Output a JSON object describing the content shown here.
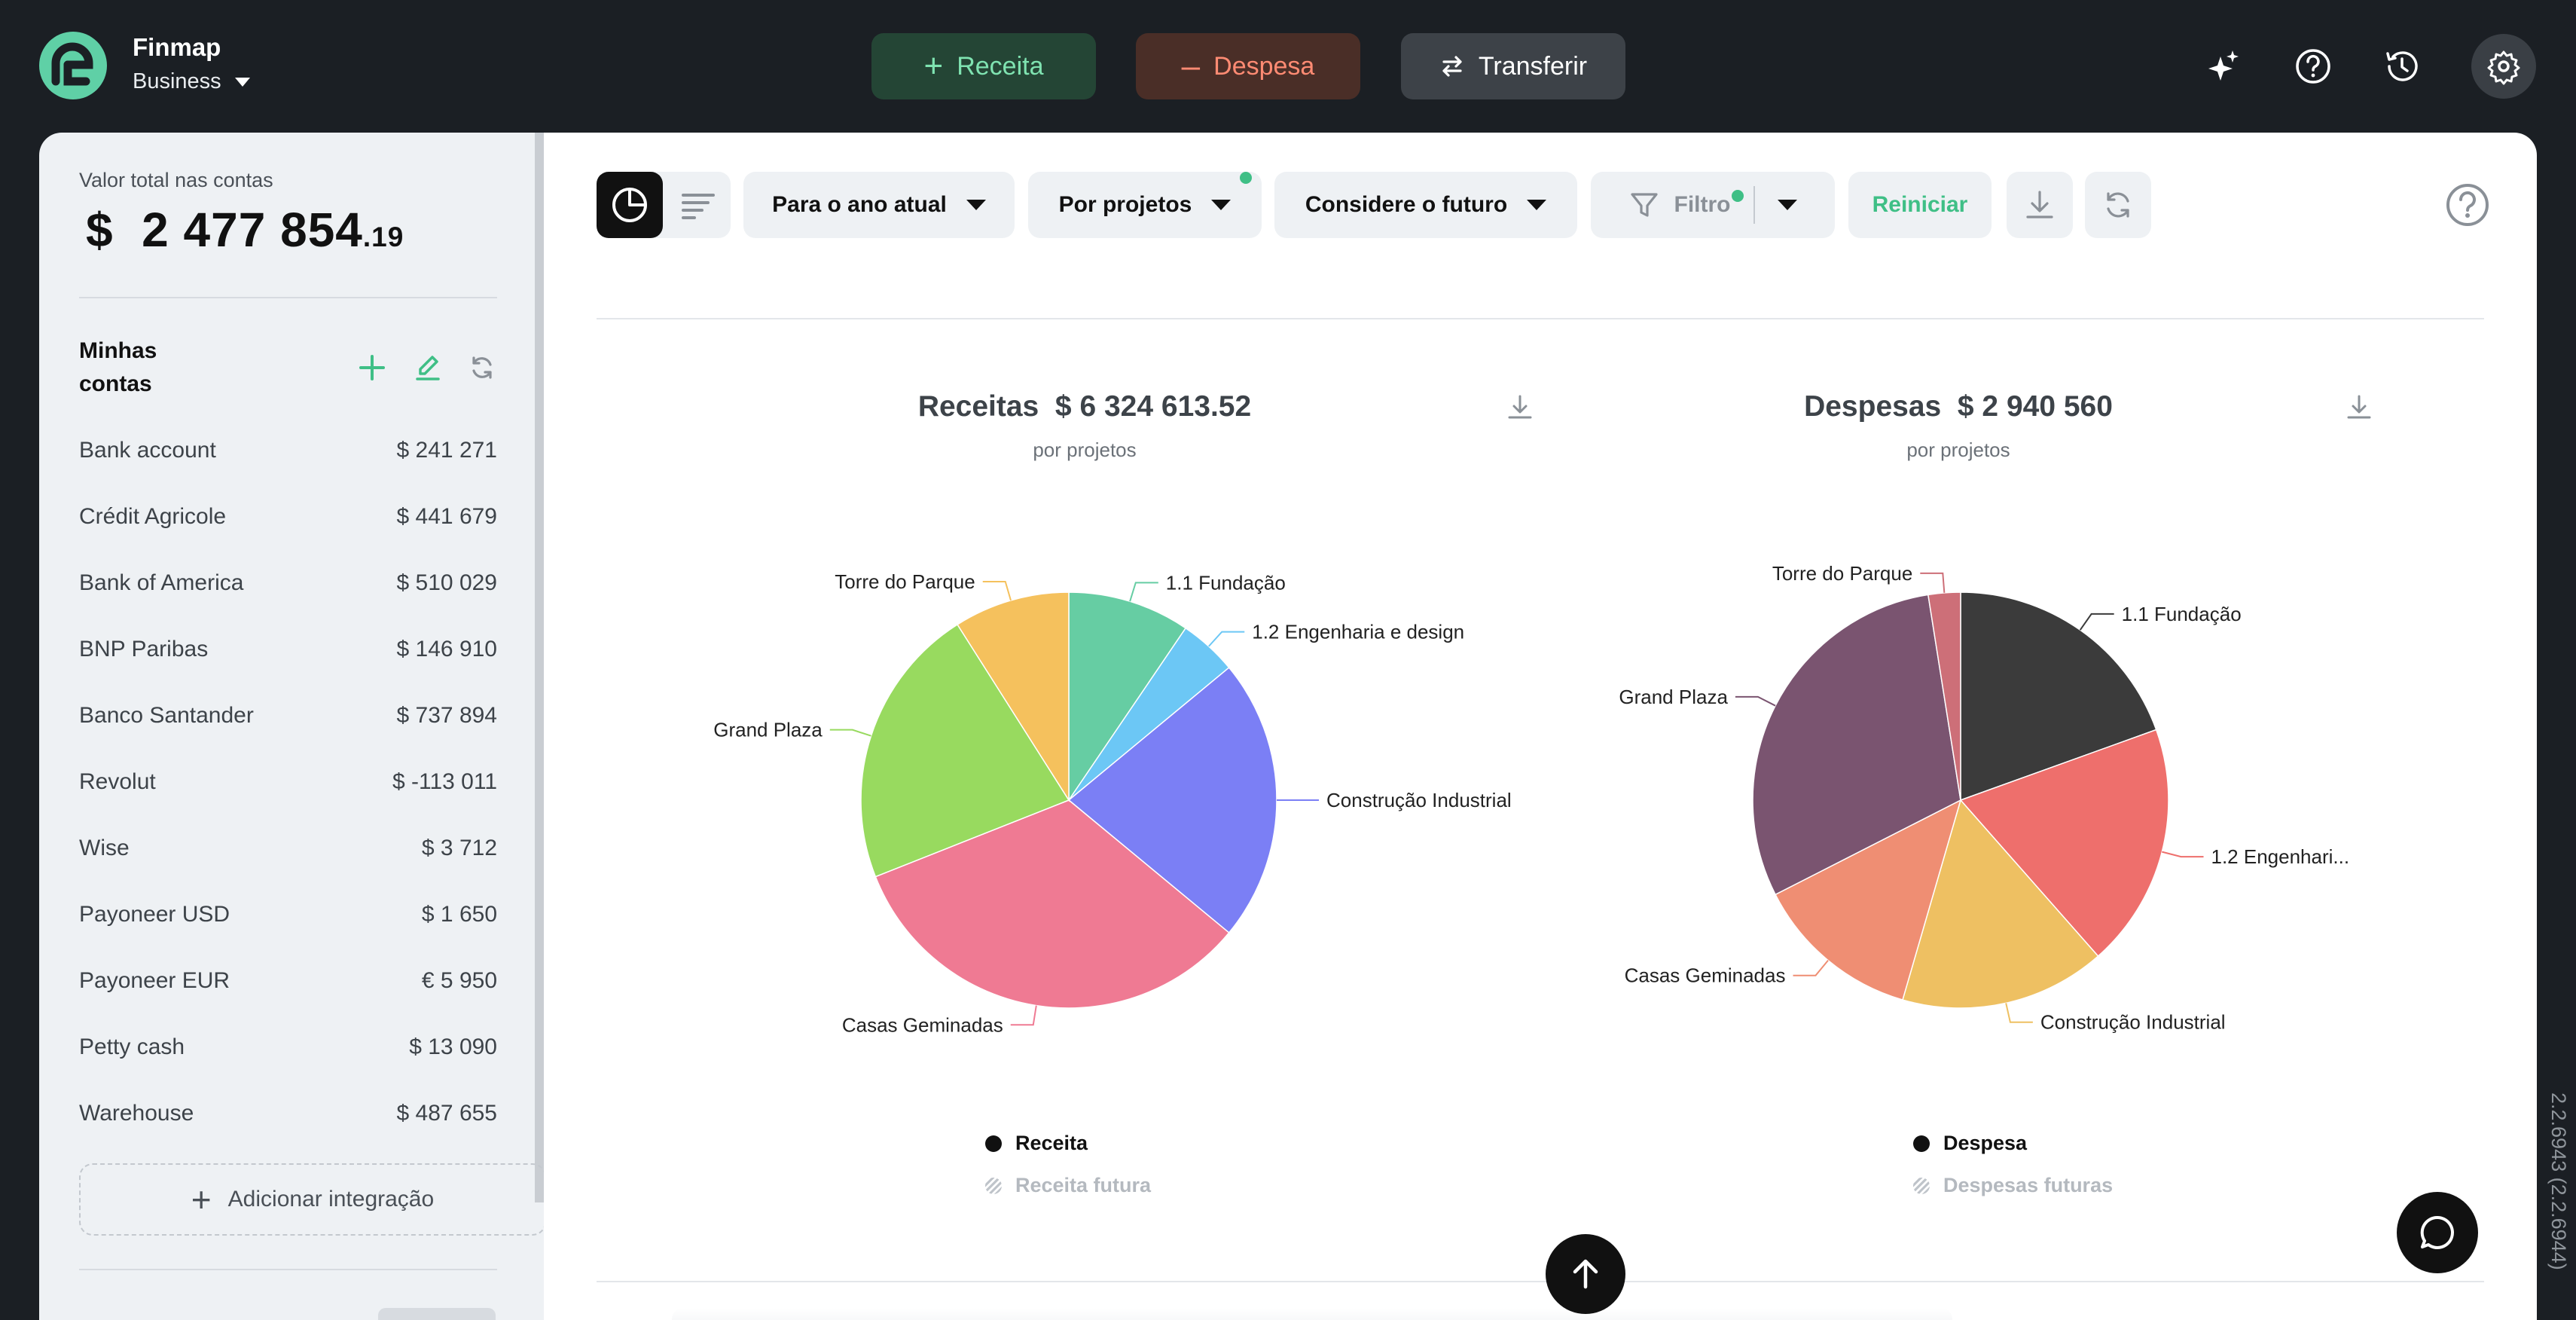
{
  "app": {
    "name": "Finmap",
    "plan": "Business",
    "version": "2.2.6943 (2.2.6944)"
  },
  "colors": {
    "brand_green": "#3fbf86",
    "income_bg": "#244535",
    "income_fg": "#7fe3b1",
    "expense_bg": "#4a2e27",
    "expense_fg": "#ff8b73"
  },
  "top_actions": {
    "income": "Receita",
    "expense": "Despesa",
    "transfer": "Transferir"
  },
  "top_icons": [
    "sparkle-icon",
    "help-icon",
    "history-icon",
    "settings-icon"
  ],
  "sidebar": {
    "total_label": "Valor total nas contas",
    "total_currency": "$",
    "total_integer": "2 477 854",
    "total_cents": ".19",
    "accounts_title": "Minhas contas",
    "accounts": [
      {
        "name": "Bank account",
        "amount": "$  241 271"
      },
      {
        "name": "Crédit Agricole",
        "amount": "$  441 679"
      },
      {
        "name": "Bank of America",
        "amount": "$  510 029"
      },
      {
        "name": "BNP Paribas",
        "amount": "$  146 910"
      },
      {
        "name": "Banco Santander",
        "amount": "$  737 894"
      },
      {
        "name": "Revolut",
        "amount": "$  -113 011"
      },
      {
        "name": "Wise",
        "amount": "$  3 712"
      },
      {
        "name": "Payoneer USD",
        "amount": "$  1 650"
      },
      {
        "name": "Payoneer EUR",
        "amount": "€ 5 950"
      },
      {
        "name": "Petty cash",
        "amount": "$  13 090"
      },
      {
        "name": "Warehouse",
        "amount": "$  487 655"
      }
    ],
    "add_integration": "Adicionar integração"
  },
  "toolbar": {
    "period": "Para o ano atual",
    "grouping": "Por projetos",
    "future": "Considere o futuro",
    "filter": "Filtro",
    "reset": "Reiniciar"
  },
  "charts": {
    "income": {
      "title_label": "Receitas",
      "title_amount": "$  6 324 613.52",
      "subtitle": "por projetos",
      "legend_main": "Receita",
      "legend_future": "Receita futura"
    },
    "expense": {
      "title_label": "Despesas",
      "title_amount": "$  2 940 560",
      "subtitle": "por projetos",
      "legend_main": "Despesa",
      "legend_future": "Despesas futuras"
    }
  },
  "chart_data": [
    {
      "type": "pie",
      "title": "Receitas $ 6 324 613.52",
      "subtitle": "por projetos",
      "slices": [
        {
          "label": "1.1 Fundação",
          "percent": 9.5,
          "color": "#66cda3"
        },
        {
          "label": "1.2 Engenharia e design",
          "percent": 4.5,
          "color": "#6cc7f5"
        },
        {
          "label": "Construção Industrial",
          "percent": 22.0,
          "color": "#7b7ff5"
        },
        {
          "label": "Casas Geminadas",
          "percent": 33.0,
          "color": "#ef7a93"
        },
        {
          "label": "Grand Plaza",
          "percent": 22.0,
          "color": "#98da5f"
        },
        {
          "label": "Torre do Parque",
          "percent": 9.0,
          "color": "#f5c15d"
        }
      ],
      "legend": [
        "Receita",
        "Receita futura"
      ]
    },
    {
      "type": "pie",
      "title": "Despesas $ 2 940 560",
      "subtitle": "por projetos",
      "slices": [
        {
          "label": "1.1 Fundação",
          "percent": 19.5,
          "color": "#3b3b3b"
        },
        {
          "label": "1.2 Engenhari...",
          "percent": 19.0,
          "color": "#ee6f6c"
        },
        {
          "label": "Construção Industrial",
          "percent": 16.0,
          "color": "#eec062"
        },
        {
          "label": "Casas Geminadas",
          "percent": 13.0,
          "color": "#ef8e73"
        },
        {
          "label": "Grand Plaza",
          "percent": 30.0,
          "color": "#7a5470"
        },
        {
          "label": "Torre do Parque",
          "percent": 2.5,
          "color": "#cd6f78"
        }
      ],
      "legend": [
        "Despesa",
        "Despesas futuras"
      ]
    }
  ]
}
